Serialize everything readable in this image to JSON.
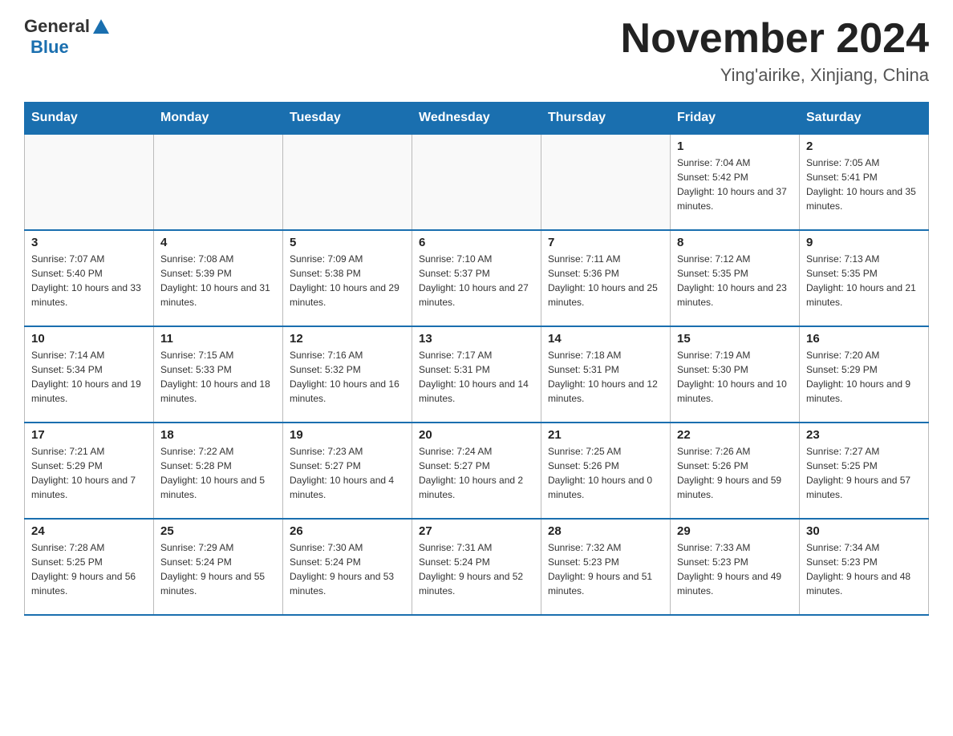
{
  "header": {
    "logo": {
      "text1": "General",
      "text2": "Blue"
    },
    "title": "November 2024",
    "location": "Ying'airike, Xinjiang, China"
  },
  "weekdays": [
    "Sunday",
    "Monday",
    "Tuesday",
    "Wednesday",
    "Thursday",
    "Friday",
    "Saturday"
  ],
  "weeks": [
    [
      {
        "day": "",
        "info": ""
      },
      {
        "day": "",
        "info": ""
      },
      {
        "day": "",
        "info": ""
      },
      {
        "day": "",
        "info": ""
      },
      {
        "day": "",
        "info": ""
      },
      {
        "day": "1",
        "info": "Sunrise: 7:04 AM\nSunset: 5:42 PM\nDaylight: 10 hours and 37 minutes."
      },
      {
        "day": "2",
        "info": "Sunrise: 7:05 AM\nSunset: 5:41 PM\nDaylight: 10 hours and 35 minutes."
      }
    ],
    [
      {
        "day": "3",
        "info": "Sunrise: 7:07 AM\nSunset: 5:40 PM\nDaylight: 10 hours and 33 minutes."
      },
      {
        "day": "4",
        "info": "Sunrise: 7:08 AM\nSunset: 5:39 PM\nDaylight: 10 hours and 31 minutes."
      },
      {
        "day": "5",
        "info": "Sunrise: 7:09 AM\nSunset: 5:38 PM\nDaylight: 10 hours and 29 minutes."
      },
      {
        "day": "6",
        "info": "Sunrise: 7:10 AM\nSunset: 5:37 PM\nDaylight: 10 hours and 27 minutes."
      },
      {
        "day": "7",
        "info": "Sunrise: 7:11 AM\nSunset: 5:36 PM\nDaylight: 10 hours and 25 minutes."
      },
      {
        "day": "8",
        "info": "Sunrise: 7:12 AM\nSunset: 5:35 PM\nDaylight: 10 hours and 23 minutes."
      },
      {
        "day": "9",
        "info": "Sunrise: 7:13 AM\nSunset: 5:35 PM\nDaylight: 10 hours and 21 minutes."
      }
    ],
    [
      {
        "day": "10",
        "info": "Sunrise: 7:14 AM\nSunset: 5:34 PM\nDaylight: 10 hours and 19 minutes."
      },
      {
        "day": "11",
        "info": "Sunrise: 7:15 AM\nSunset: 5:33 PM\nDaylight: 10 hours and 18 minutes."
      },
      {
        "day": "12",
        "info": "Sunrise: 7:16 AM\nSunset: 5:32 PM\nDaylight: 10 hours and 16 minutes."
      },
      {
        "day": "13",
        "info": "Sunrise: 7:17 AM\nSunset: 5:31 PM\nDaylight: 10 hours and 14 minutes."
      },
      {
        "day": "14",
        "info": "Sunrise: 7:18 AM\nSunset: 5:31 PM\nDaylight: 10 hours and 12 minutes."
      },
      {
        "day": "15",
        "info": "Sunrise: 7:19 AM\nSunset: 5:30 PM\nDaylight: 10 hours and 10 minutes."
      },
      {
        "day": "16",
        "info": "Sunrise: 7:20 AM\nSunset: 5:29 PM\nDaylight: 10 hours and 9 minutes."
      }
    ],
    [
      {
        "day": "17",
        "info": "Sunrise: 7:21 AM\nSunset: 5:29 PM\nDaylight: 10 hours and 7 minutes."
      },
      {
        "day": "18",
        "info": "Sunrise: 7:22 AM\nSunset: 5:28 PM\nDaylight: 10 hours and 5 minutes."
      },
      {
        "day": "19",
        "info": "Sunrise: 7:23 AM\nSunset: 5:27 PM\nDaylight: 10 hours and 4 minutes."
      },
      {
        "day": "20",
        "info": "Sunrise: 7:24 AM\nSunset: 5:27 PM\nDaylight: 10 hours and 2 minutes."
      },
      {
        "day": "21",
        "info": "Sunrise: 7:25 AM\nSunset: 5:26 PM\nDaylight: 10 hours and 0 minutes."
      },
      {
        "day": "22",
        "info": "Sunrise: 7:26 AM\nSunset: 5:26 PM\nDaylight: 9 hours and 59 minutes."
      },
      {
        "day": "23",
        "info": "Sunrise: 7:27 AM\nSunset: 5:25 PM\nDaylight: 9 hours and 57 minutes."
      }
    ],
    [
      {
        "day": "24",
        "info": "Sunrise: 7:28 AM\nSunset: 5:25 PM\nDaylight: 9 hours and 56 minutes."
      },
      {
        "day": "25",
        "info": "Sunrise: 7:29 AM\nSunset: 5:24 PM\nDaylight: 9 hours and 55 minutes."
      },
      {
        "day": "26",
        "info": "Sunrise: 7:30 AM\nSunset: 5:24 PM\nDaylight: 9 hours and 53 minutes."
      },
      {
        "day": "27",
        "info": "Sunrise: 7:31 AM\nSunset: 5:24 PM\nDaylight: 9 hours and 52 minutes."
      },
      {
        "day": "28",
        "info": "Sunrise: 7:32 AM\nSunset: 5:23 PM\nDaylight: 9 hours and 51 minutes."
      },
      {
        "day": "29",
        "info": "Sunrise: 7:33 AM\nSunset: 5:23 PM\nDaylight: 9 hours and 49 minutes."
      },
      {
        "day": "30",
        "info": "Sunrise: 7:34 AM\nSunset: 5:23 PM\nDaylight: 9 hours and 48 minutes."
      }
    ]
  ]
}
